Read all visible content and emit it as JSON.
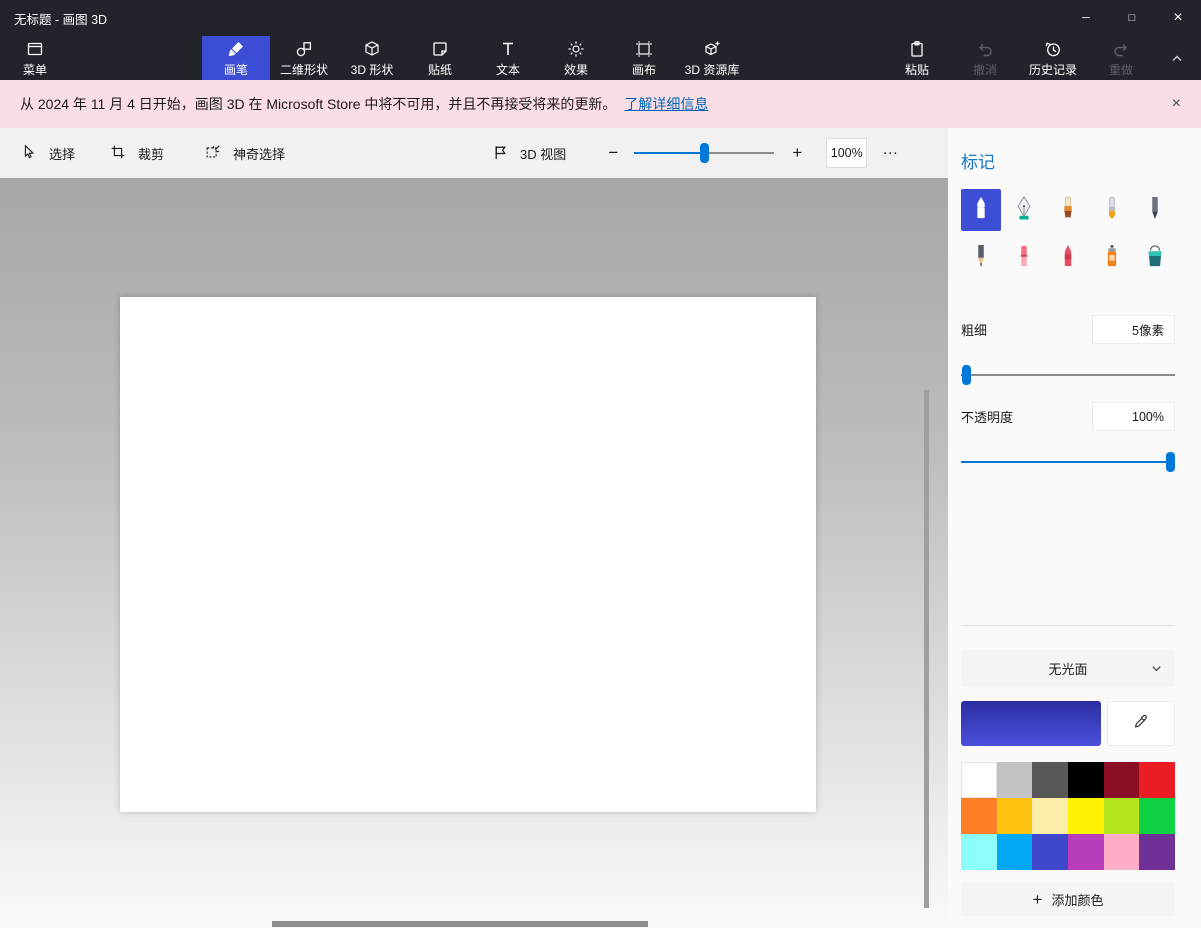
{
  "window": {
    "title": "无标题 - 画图 3D",
    "controls": {
      "minimize": "─",
      "maximize": "□",
      "close": "×"
    }
  },
  "ribbon": {
    "menu_label": "菜单",
    "tabs": [
      {
        "label": "画笔",
        "selected": true
      },
      {
        "label": "二维形状",
        "selected": false
      },
      {
        "label": "3D 形状",
        "selected": false
      },
      {
        "label": "贴纸",
        "selected": false
      },
      {
        "label": "文本",
        "selected": false
      },
      {
        "label": "效果",
        "selected": false
      },
      {
        "label": "画布",
        "selected": false
      },
      {
        "label": "3D 资源库",
        "selected": false
      }
    ],
    "actions": [
      {
        "label": "粘贴",
        "disabled": false
      },
      {
        "label": "撤消",
        "disabled": true
      },
      {
        "label": "历史记录",
        "disabled": false
      },
      {
        "label": "重做",
        "disabled": true
      }
    ]
  },
  "banner": {
    "message": "从 2024 年 11 月 4 日开始，画图 3D 在 Microsoft Store 中将不可用，并且不再接受将来的更新。",
    "link_label": "了解详细信息",
    "close_glyph": "×"
  },
  "toolbar": {
    "select_label": "选择",
    "crop_label": "裁剪",
    "magic_select_label": "神奇选择",
    "view3d_label": "3D 视图",
    "zoom_out_glyph": "−",
    "zoom_in_glyph": "+",
    "zoom_value": "100%",
    "more_glyph": "…"
  },
  "panel": {
    "title": "标记",
    "brushes": [
      "marker",
      "calligraphy-pen",
      "oil-brush",
      "watercolor",
      "pixel-pen",
      "pencil",
      "eraser",
      "crayon",
      "spray-can",
      "fill"
    ],
    "selected_brush": "marker",
    "thickness_label": "粗细",
    "thickness_value": "5像素",
    "thickness_percent": 3,
    "opacity_label": "不透明度",
    "opacity_value": "100%",
    "opacity_percent": 100,
    "finish_selected": "无光面",
    "color_swatch_gradient": "linear-gradient(180deg, #2b2da1 0%, #4a50dc 100%)",
    "palette": [
      "#ffffff",
      "#c3c3c3",
      "#585858",
      "#000000",
      "#8a0f24",
      "#ec1c24",
      "#ff7f27",
      "#ffc20e",
      "#fcedaa",
      "#fff200",
      "#b5e61d",
      "#0ed145",
      "#8cfffb",
      "#00a8f3",
      "#3f48cc",
      "#b83dba",
      "#ffaec8",
      "#6f3198"
    ],
    "add_color_glyph": "+",
    "add_color_label": "添加颜色"
  },
  "colors": {
    "titlebar_bg": "#23232b",
    "accent_tab": "#3d4ed6",
    "banner_bg": "#fbdee5",
    "link": "#0067b8",
    "slider_accent": "#0078d7",
    "panel_title": "#1377c4"
  }
}
